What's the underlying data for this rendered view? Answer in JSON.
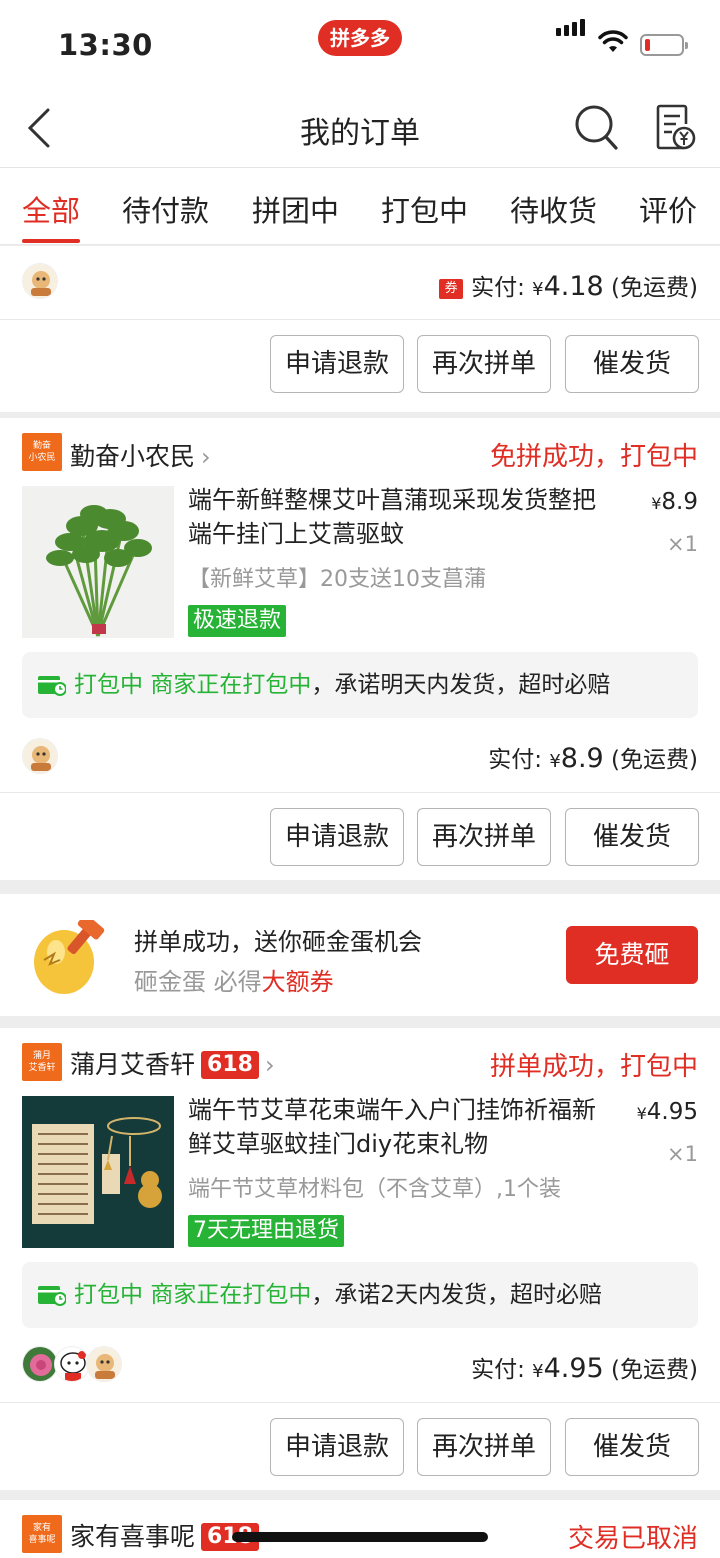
{
  "status_bar": {
    "time": "13:30",
    "brand_badge": "拼多多"
  },
  "header": {
    "title": "我的订单",
    "back_icon": "chevron-left-icon",
    "search_icon": "search-icon",
    "bill_icon": "bill-yen-icon"
  },
  "tabs": [
    "全部",
    "待付款",
    "拼团中",
    "打包中",
    "待收货",
    "评价"
  ],
  "active_tab": "全部",
  "order0": {
    "coupon": "券",
    "paid_label": "实付:",
    "currency": "¥",
    "paid_amount": "4.18",
    "shipping": "(免运费)",
    "buttons": [
      "申请退款",
      "再次拼单",
      "催发货"
    ]
  },
  "order1": {
    "shop_logo": [
      "勤奋",
      "小农民"
    ],
    "shop_name": "勤奋小农民",
    "status": "免拼成功，打包中",
    "product_name": "端午新鲜整棵艾叶菖蒲现采现发货整把端午挂门上艾蒿驱蚊",
    "product_spec": "【新鲜艾草】20支送10支菖蒲",
    "badge": "极速退款",
    "currency": "¥",
    "price": "8.9",
    "qty": "×1",
    "notice_status": "打包中",
    "notice_green": "商家正在打包中",
    "notice_text": "，承诺明天内发货，超时必赔",
    "paid_label": "实付:",
    "paid_amount": "8.9",
    "shipping": "(免运费)",
    "buttons": [
      "申请退款",
      "再次拼单",
      "催发货"
    ]
  },
  "egg": {
    "title": "拼单成功，送你砸金蛋机会",
    "sub_gray": "砸金蛋 必得",
    "sub_red": "大额券",
    "button": "免费砸"
  },
  "order2": {
    "shop_logo": [
      "蒲月",
      "艾香轩"
    ],
    "shop_name": "蒲月艾香轩",
    "tag": "618",
    "status": "拼单成功，打包中",
    "product_name": "端午节艾草花束端午入户门挂饰祈福新鲜艾草驱蚊挂门diy花束礼物",
    "product_spec": "端午节艾草材料包（不含艾草）,1个装",
    "badge": "7天无理由退货",
    "currency": "¥",
    "price": "4.95",
    "qty": "×1",
    "notice_status": "打包中",
    "notice_green": "商家正在打包中",
    "notice_text": "，承诺2天内发货，超时必赔",
    "paid_label": "实付:",
    "paid_amount": "4.95",
    "shipping": "(免运费)",
    "buttons": [
      "申请退款",
      "再次拼单",
      "催发货"
    ]
  },
  "order3": {
    "shop_logo": [
      "家有",
      "喜事呢"
    ],
    "shop_name": "家有喜事呢",
    "tag": "618",
    "status": "交易已取消"
  }
}
